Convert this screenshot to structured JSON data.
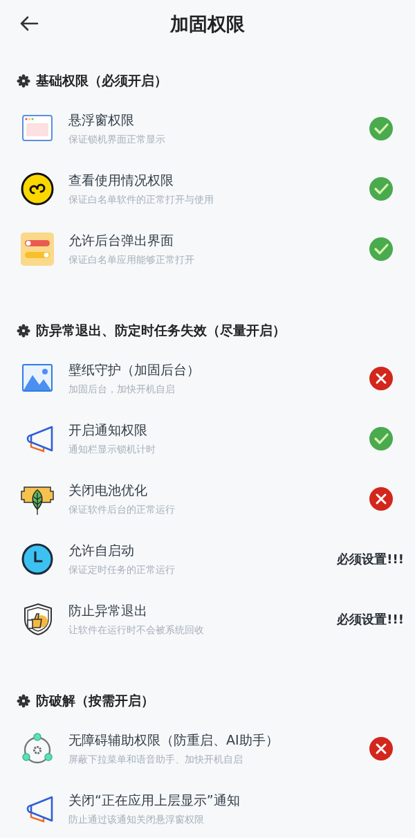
{
  "header": {
    "title": "加固权限"
  },
  "sections": [
    {
      "title": "基础权限（必须开启）",
      "items": [
        {
          "kind": "window",
          "title": "悬浮窗权限",
          "subtitle": "保证锁机界面正常显示",
          "checked": true
        },
        {
          "kind": "infinity",
          "title": "查看使用情况权限",
          "subtitle": "保证白名单软件的正常打开与使用",
          "checked": true
        },
        {
          "kind": "toggles",
          "title": "允许后台弹出界面",
          "subtitle": "保证白名单应用能够正常打开",
          "checked": true
        }
      ]
    },
    {
      "title": "防异常退出、防定时任务失效（尽量开启）",
      "items": [
        {
          "kind": "image",
          "title": "壁纸守护（加固后台）",
          "subtitle": "加固后台，加快开机自启",
          "checked": false
        },
        {
          "kind": "megaphone",
          "title": "开启通知权限",
          "subtitle": "通知栏显示锁机计时",
          "checked": true
        },
        {
          "kind": "battery",
          "title": "关闭电池优化",
          "subtitle": "保证软件后台的正常运行",
          "checked": false
        },
        {
          "kind": "clock",
          "title": "允许自启动",
          "subtitle": "保证定时任务的正常运行",
          "note": "必须设置!!!"
        },
        {
          "kind": "shield",
          "title": "防止异常退出",
          "subtitle": "让软件在运行时不会被系统回收",
          "note": "必须设置!!!"
        }
      ]
    },
    {
      "title": "防破解（按需开启）",
      "items": [
        {
          "kind": "network",
          "title": "无障碍辅助权限（防重启、AI助手）",
          "subtitle": "屏蔽下拉菜单和语音助手、加快开机自启",
          "checked": false
        },
        {
          "kind": "megaphone",
          "title": "关闭“正在应用上层显示”通知",
          "subtitle": "防止通过该通知关闭悬浮窗权限"
        }
      ]
    }
  ]
}
